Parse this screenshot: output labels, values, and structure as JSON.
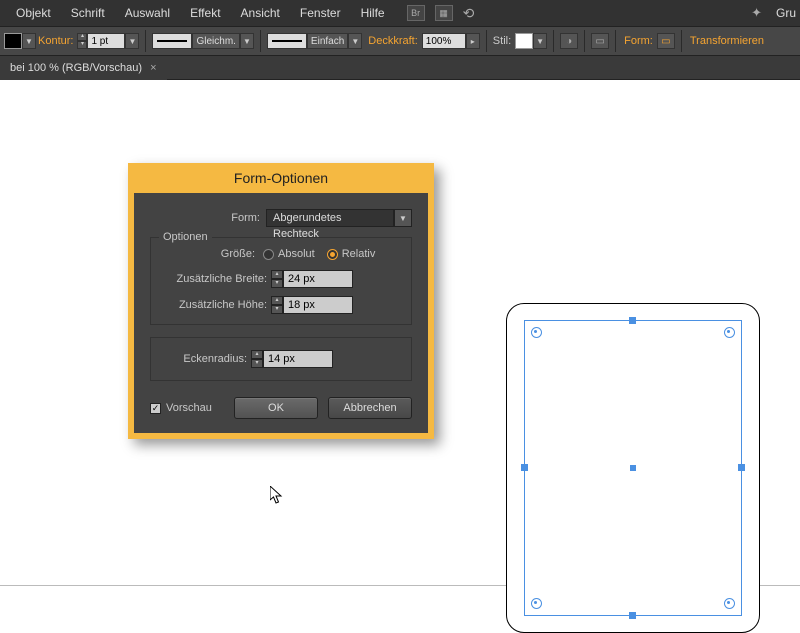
{
  "menubar": {
    "items": [
      "Objekt",
      "Schrift",
      "Auswahl",
      "Effekt",
      "Ansicht",
      "Fenster",
      "Hilfe"
    ],
    "br_label": "Br",
    "right_text": "Gru"
  },
  "controlbar": {
    "kontur_label": "Kontur:",
    "stroke_value": "1 pt",
    "cap1_label": "Gleichm.",
    "cap2_label": "Einfach",
    "opacity_label": "Deckkraft:",
    "opacity_value": "100%",
    "stil_label": "Stil:",
    "form_label": "Form:",
    "transform_label": "Transformieren"
  },
  "tab": {
    "title": "bei 100 % (RGB/Vorschau)"
  },
  "dialog": {
    "title": "Form-Optionen",
    "form_label": "Form:",
    "form_value": "Abgerundetes Rechteck",
    "options_group": "Optionen",
    "size_label": "Größe:",
    "size_absolute": "Absolut",
    "size_relative": "Relativ",
    "size_selected": "relative",
    "extra_width_label": "Zusätzliche Breite:",
    "extra_width_value": "24 px",
    "extra_height_label": "Zusätzliche Höhe:",
    "extra_height_value": "18 px",
    "corner_radius_label": "Eckenradius:",
    "corner_radius_value": "14 px",
    "preview_label": "Vorschau",
    "preview_checked": true,
    "ok_label": "OK",
    "cancel_label": "Abbrechen"
  }
}
